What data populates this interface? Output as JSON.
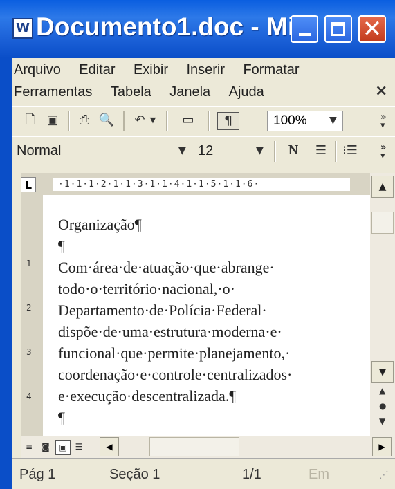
{
  "window": {
    "title": "Documento1.doc - Mi...",
    "app_icon": "word-doc-icon",
    "controls": [
      "minimize-icon",
      "maximize-icon",
      "close-icon"
    ]
  },
  "menubar": {
    "row1": [
      "Arquivo",
      "Editar",
      "Exibir",
      "Inserir",
      "Formatar"
    ],
    "row2": [
      "Ferramentas",
      "Tabela",
      "Janela",
      "Ajuda"
    ],
    "close_glyph": "×"
  },
  "toolbar_standard": {
    "icons": [
      "new-document-icon",
      "save-icon",
      "print-icon",
      "print-preview-icon",
      "undo-icon",
      "table-icon",
      "show-formatting-icon"
    ],
    "zoom": "100%"
  },
  "toolbar_formatting": {
    "style": "Normal",
    "font_size": "12",
    "icons": [
      "bold-icon",
      "align-right-icon",
      "numbered-list-icon"
    ]
  },
  "ruler": {
    "marks": "·1·1·1·2·1·1·3·1·1·4·1·1·5·1·1·6·"
  },
  "vruler_marks": [
    "1",
    "2",
    "3",
    "4"
  ],
  "document": {
    "lines": [
      "Organização¶",
      "¶",
      "Com·área·de·atuação·que·abrange·",
      "todo·o·território·nacional,·o·",
      "Departamento·de·Polícia·Federal·",
      "dispõe·de·uma·estrutura·moderna·e·",
      "funcional·que·permite·planejamento,·",
      "coordenação·e·controle·centralizados·",
      "e·execução·descentralizada.¶",
      "¶"
    ]
  },
  "statusbar": {
    "page": "Pág 1",
    "section": "Seção 1",
    "pages": "1/1",
    "position": "Em"
  }
}
